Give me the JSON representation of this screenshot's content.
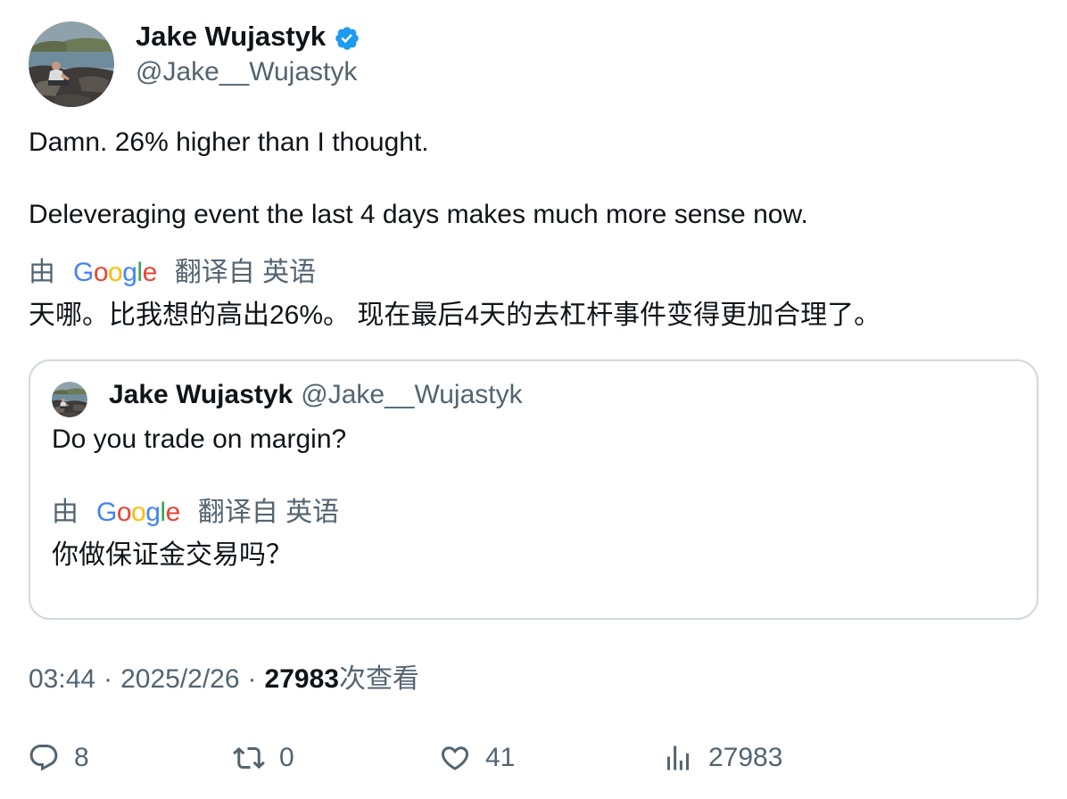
{
  "tweet": {
    "author": {
      "name": "Jake Wujastyk",
      "handle": "@Jake__Wujastyk",
      "verified": true
    },
    "paragraphs": [
      "Damn. 26% higher than I thought.",
      "Deleveraging event the last 4 days makes much more sense now."
    ],
    "translation": {
      "prefix": "由",
      "provider": "Google",
      "label": "翻译自 英语",
      "text": "天哪。比我想的高出26%。 现在最后4天的去杠杆事件变得更加合理了。"
    },
    "quote": {
      "author": {
        "name": "Jake Wujastyk",
        "handle": "@Jake__Wujastyk"
      },
      "text": "Do you trade on margin?",
      "translation": {
        "prefix": "由",
        "provider": "Google",
        "label": "翻译自 英语",
        "text": "你做保证金交易吗？"
      }
    },
    "meta": {
      "time": "03:44",
      "separator": "·",
      "date": "2025/2/26",
      "views": "27983",
      "views_label": "次查看"
    },
    "actions": [
      {
        "icon": "reply-icon",
        "count": "8"
      },
      {
        "icon": "retweet-icon",
        "count": "0"
      },
      {
        "icon": "heart-icon",
        "count": "41"
      },
      {
        "icon": "views-icon",
        "count": "27983"
      }
    ]
  },
  "colors": {
    "text": "#0f1419",
    "secondary": "#536471",
    "border": "#cfd9de",
    "verified": "#1d9bf0",
    "google_logo": [
      "#4285F4",
      "#EA4335",
      "#FBBC05",
      "#4285F4",
      "#34A853",
      "#EA4335"
    ]
  }
}
